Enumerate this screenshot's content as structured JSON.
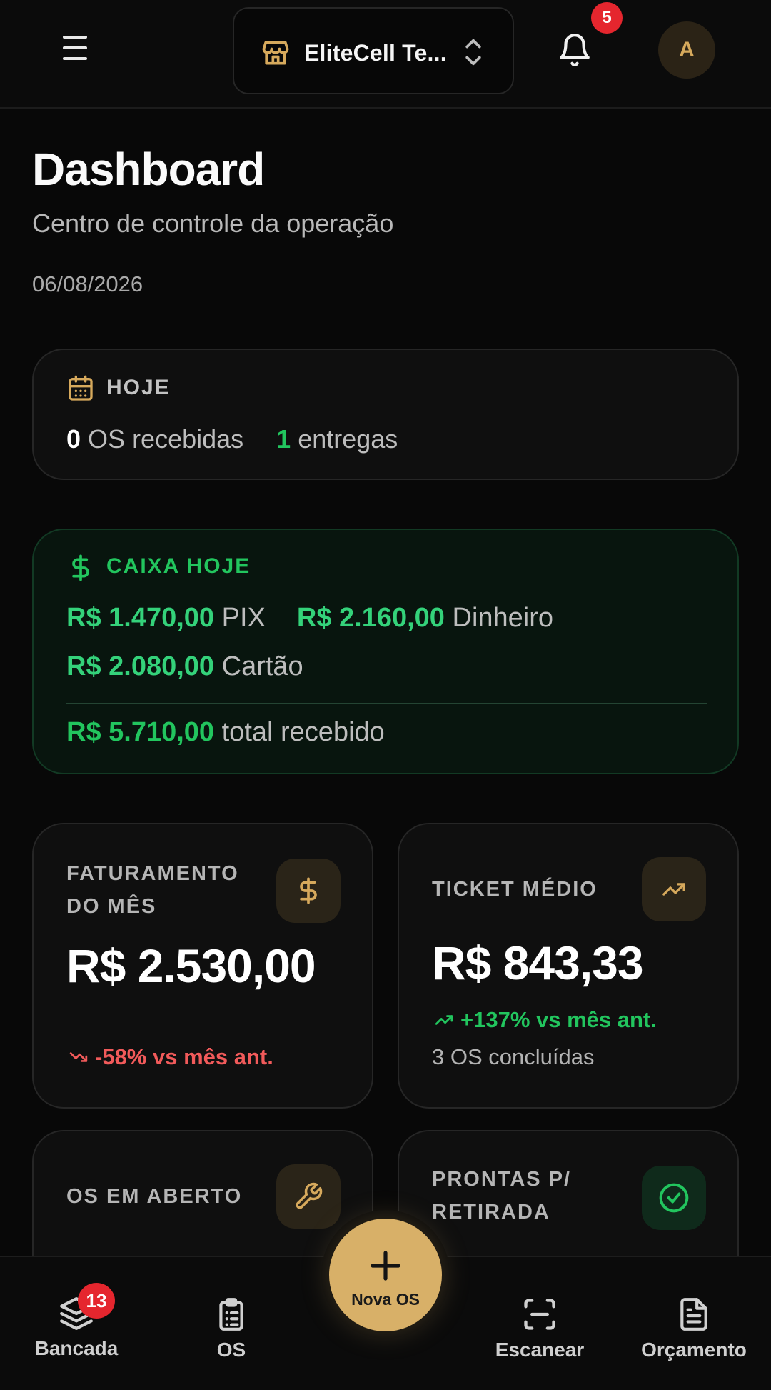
{
  "header": {
    "store_name": "EliteCell Te...",
    "notifications_count": "5",
    "avatar_initial": "A"
  },
  "page": {
    "title": "Dashboard",
    "subtitle": "Centro de controle da operação",
    "date": "06/08/2026"
  },
  "today": {
    "label": "HOJE",
    "os_received_count": "0",
    "os_received_text": "OS recebidas",
    "deliveries_count": "1",
    "deliveries_text": "entregas"
  },
  "cash": {
    "label": "CAIXA HOJE",
    "pix_value": "R$ 1.470,00",
    "pix_label": "PIX",
    "cash_value": "R$ 2.160,00",
    "cash_label": "Dinheiro",
    "card_value": "R$ 2.080,00",
    "card_label": "Cartão",
    "total_value": "R$ 5.710,00",
    "total_label": "total recebido",
    "accent_color": "#22c55e"
  },
  "stats": {
    "revenue": {
      "title_line1": "FATURAMENTO",
      "title_line2": "DO MÊS",
      "value": "R$ 2.530,00",
      "trend": "-58% vs mês ant.",
      "icon": "dollar-icon"
    },
    "ticket": {
      "title": "TICKET MÉDIO",
      "value": "R$ 843,33",
      "trend": "+137% vs mês ant.",
      "note": "3 OS concluídas",
      "icon": "trending-up-icon"
    },
    "open": {
      "title": "OS EM ABERTO",
      "icon": "wrench-icon"
    },
    "ready": {
      "title_line1": "PRONTAS P/",
      "title_line2": "RETIRADA",
      "icon": "check-circle-icon"
    }
  },
  "bottom_nav": {
    "bench_label": "Bancada",
    "bench_badge": "13",
    "os_label": "OS",
    "fab_label": "Nova OS",
    "scan_label": "Escanear",
    "quote_label": "Orçamento"
  },
  "colors": {
    "gold": "#d8b068",
    "green": "#22c55e",
    "red": "#e5262e"
  }
}
